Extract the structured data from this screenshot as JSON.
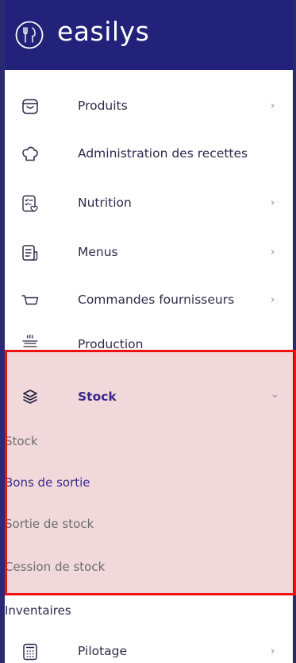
{
  "brand": {
    "name": "easilys"
  },
  "nav": {
    "produits": {
      "label": "Produits",
      "chevron": "›",
      "icon": "basket-icon"
    },
    "recettes": {
      "label": "Administration des recettes",
      "icon": "chef-hat-icon"
    },
    "nutrition": {
      "label": "Nutrition",
      "chevron": "›",
      "icon": "nutrition-sheet-icon"
    },
    "menus": {
      "label": "Menus",
      "chevron": "›",
      "icon": "menu-document-icon"
    },
    "commandes": {
      "label": "Commandes fournisseurs",
      "chevron": "›",
      "icon": "cart-icon"
    },
    "production": {
      "label": "Production",
      "icon": "cooking-pot-icon"
    },
    "stock": {
      "label": "Stock",
      "chevron": "⌄",
      "icon": "layers-icon"
    },
    "pilotage": {
      "label": "Pilotage",
      "chevron": "›",
      "icon": "calculator-icon"
    }
  },
  "stock_submenu": [
    {
      "label": "Stock"
    },
    {
      "label": "Bons de sortie"
    },
    {
      "label": "Sortie de stock"
    },
    {
      "label": "Cession de stock"
    }
  ],
  "inventaires": {
    "label": "Inventaires"
  },
  "colors": {
    "header_bg": "#22227a",
    "selected_bg": "#f1d9db",
    "highlight_border": "#ee1111",
    "active_text": "#3a2a8a",
    "muted_text": "#6b6b6b"
  }
}
